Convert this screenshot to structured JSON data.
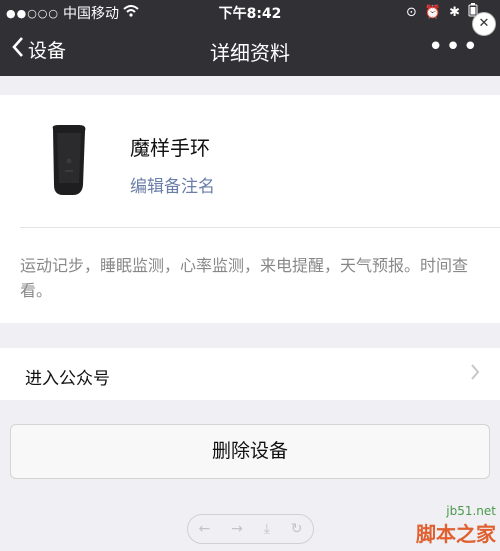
{
  "status": {
    "carrier": "中国移动",
    "time": "下午8:42"
  },
  "nav": {
    "back_label": "设备",
    "title": "详细资料",
    "more_label": "•••"
  },
  "device": {
    "name": "魔样手环",
    "edit_note": "编辑备注名",
    "description": "运动记步，睡眠监测，心率监测，来电提醒，天气预报。时间查看。"
  },
  "entry": {
    "label": "进入公众号"
  },
  "delete_button": "删除设备",
  "watermark": {
    "site": "jb51.net",
    "brand": "脚本之家"
  }
}
